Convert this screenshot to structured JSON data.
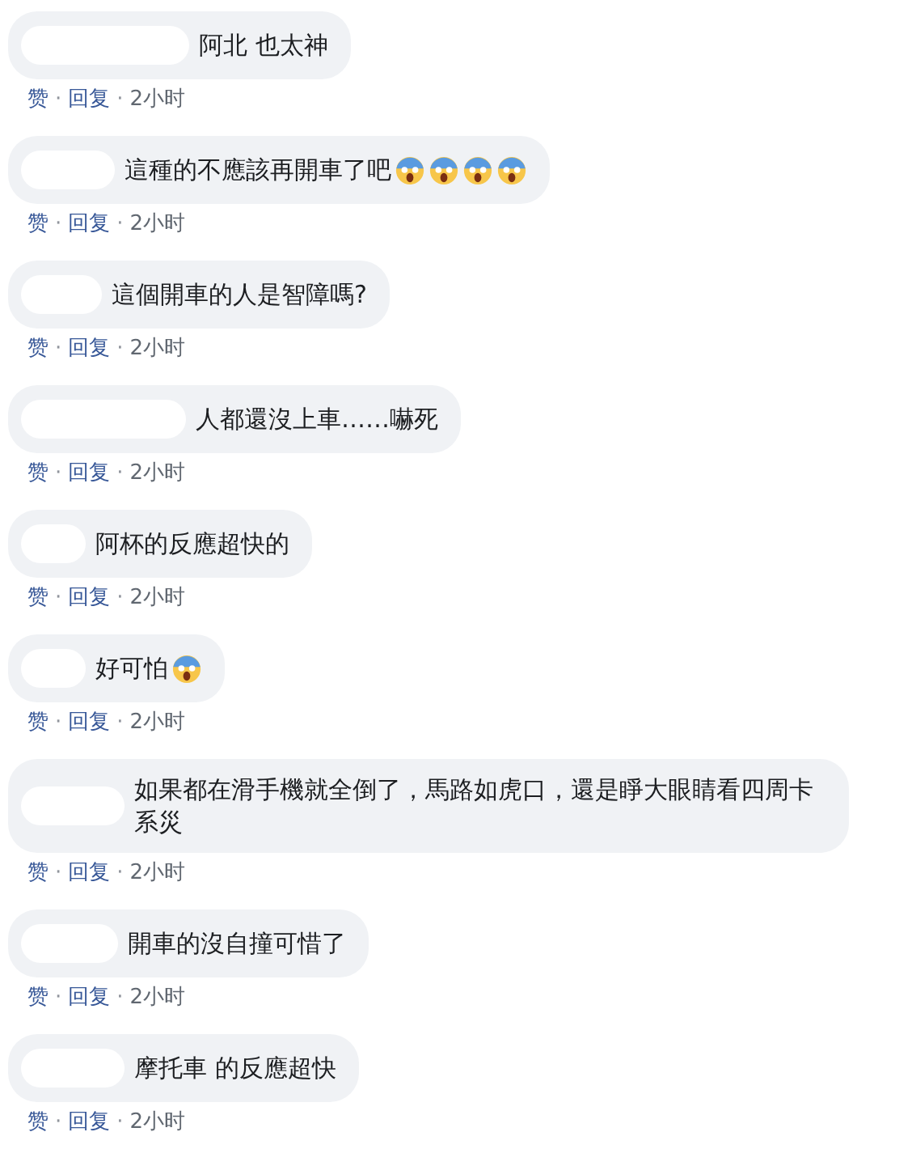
{
  "comments": [
    {
      "parts": [
        {
          "kind": "text",
          "text": "阿北 也太神"
        }
      ],
      "actions": {
        "like": "赞",
        "sep": "·",
        "reply": "回复",
        "time": "2小时"
      }
    },
    {
      "parts": [
        {
          "kind": "text",
          "text": "這種的不應該再開車了吧"
        },
        {
          "kind": "emoji"
        },
        {
          "kind": "emoji"
        },
        {
          "kind": "emoji"
        },
        {
          "kind": "emoji"
        }
      ],
      "actions": {
        "like": "赞",
        "sep": "·",
        "reply": "回复",
        "time": "2小时"
      }
    },
    {
      "parts": [
        {
          "kind": "text",
          "text": "這個開車的人是智障嗎?"
        }
      ],
      "actions": {
        "like": "赞",
        "sep": "·",
        "reply": "回复",
        "time": "2小时"
      }
    },
    {
      "parts": [
        {
          "kind": "text",
          "text": "人都還沒上車……嚇死"
        }
      ],
      "actions": {
        "like": "赞",
        "sep": "·",
        "reply": "回复",
        "time": "2小时"
      }
    },
    {
      "parts": [
        {
          "kind": "text",
          "text": "阿杯的反應超快的"
        }
      ],
      "actions": {
        "like": "赞",
        "sep": "·",
        "reply": "回复",
        "time": "2小时"
      }
    },
    {
      "parts": [
        {
          "kind": "text",
          "text": "好可怕"
        },
        {
          "kind": "emoji"
        }
      ],
      "actions": {
        "like": "赞",
        "sep": "·",
        "reply": "回复",
        "time": "2小时"
      }
    },
    {
      "parts": [
        {
          "kind": "text",
          "text": "如果都在滑手機就全倒了，馬路如虎口，還是睜大眼睛看四周卡系災"
        }
      ],
      "actions": {
        "like": "赞",
        "sep": "·",
        "reply": "回复",
        "time": "2小时"
      }
    },
    {
      "parts": [
        {
          "kind": "text",
          "text": "開車的沒自撞可惜了"
        }
      ],
      "actions": {
        "like": "赞",
        "sep": "·",
        "reply": "回复",
        "time": "2小时"
      }
    },
    {
      "parts": [
        {
          "kind": "text",
          "text": "摩托車 的反應超快"
        }
      ],
      "actions": {
        "like": "赞",
        "sep": "·",
        "reply": "回复",
        "time": "2小时"
      }
    }
  ]
}
